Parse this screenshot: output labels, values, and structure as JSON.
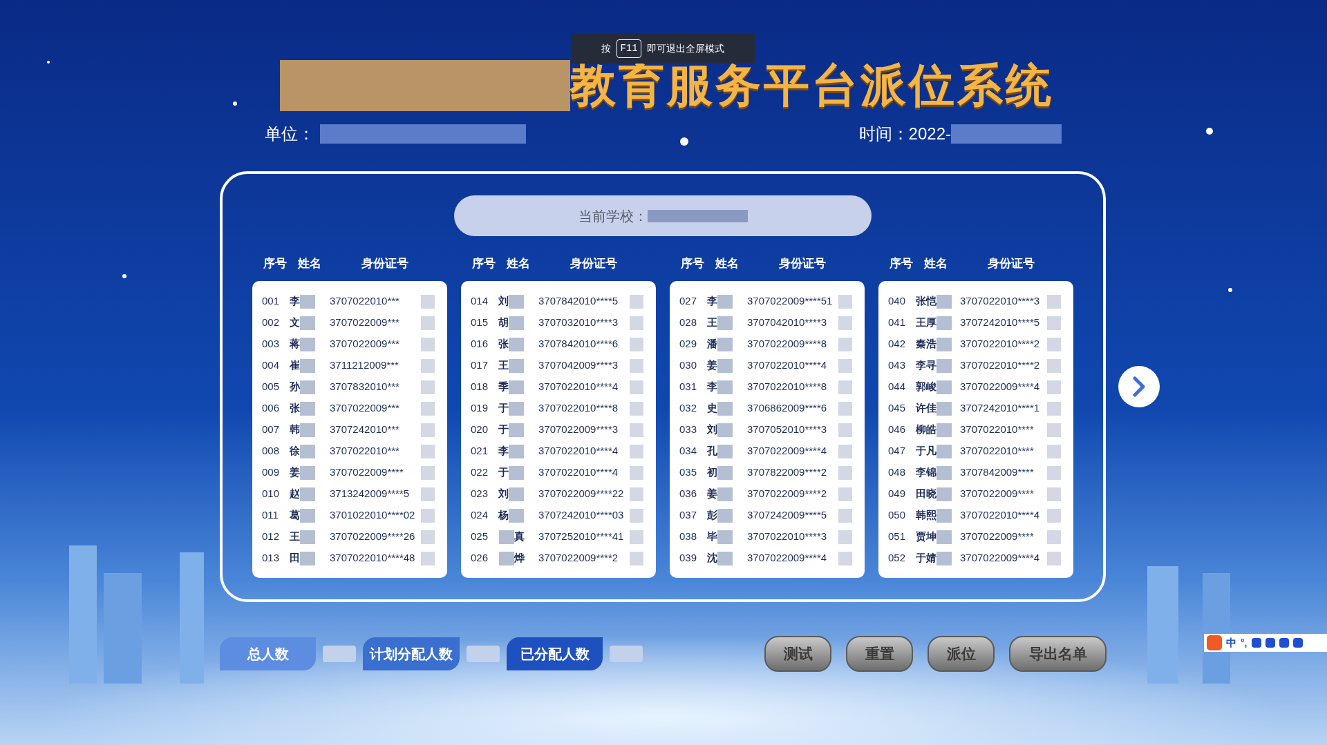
{
  "fullscreen_toast": {
    "prefix": "按",
    "key": "F11",
    "suffix": "即可退出全屏模式"
  },
  "title": "教育服务平台派位系统",
  "unit_label": "单位：",
  "time_label": "时间：",
  "time_value": "2022-",
  "school_label": "当前学校：",
  "columns": [
    {
      "headers": [
        "序号",
        "姓名",
        "身份证号"
      ],
      "rows": [
        {
          "no": "001",
          "name": "李",
          "id": "3707022010***",
          "kind": "name_first"
        },
        {
          "no": "002",
          "name": "文",
          "id": "3707022009***",
          "kind": "name_first"
        },
        {
          "no": "003",
          "name": "蒋",
          "id": "3707022009***",
          "kind": "name_first"
        },
        {
          "no": "004",
          "name": "崔",
          "id": "3711212009***",
          "kind": "name_first"
        },
        {
          "no": "005",
          "name": "孙",
          "id": "3707832010***",
          "kind": "name_first"
        },
        {
          "no": "006",
          "name": "张",
          "id": "3707022009***",
          "kind": "name_first"
        },
        {
          "no": "007",
          "name": "韩",
          "id": "3707242010***",
          "kind": "name_first"
        },
        {
          "no": "008",
          "name": "徐",
          "id": "3707022010***",
          "kind": "name_first"
        },
        {
          "no": "009",
          "name": "姜",
          "id": "3707022009****",
          "kind": "name_first"
        },
        {
          "no": "010",
          "name": "赵",
          "id": "3713242009****5",
          "kind": "name_first"
        },
        {
          "no": "011",
          "name": "葛",
          "id": "3701022010****02",
          "kind": "name_first"
        },
        {
          "no": "012",
          "name": "王",
          "id": "3707022009****26",
          "kind": "name_first"
        },
        {
          "no": "013",
          "name": "田",
          "id": "3707022010****48",
          "kind": "name_first"
        }
      ]
    },
    {
      "headers": [
        "序号",
        "姓名",
        "身份证号"
      ],
      "rows": [
        {
          "no": "014",
          "name": "刘",
          "id": "3707842010****5",
          "kind": "name_first"
        },
        {
          "no": "015",
          "name": "胡",
          "id": "3707032010****3",
          "kind": "name_first"
        },
        {
          "no": "016",
          "name": "张",
          "id": "3707842010****6",
          "kind": "name_first"
        },
        {
          "no": "017",
          "name": "王",
          "id": "3707042009****3",
          "kind": "name_first"
        },
        {
          "no": "018",
          "name": "季",
          "id": "3707022010****4",
          "kind": "name_first"
        },
        {
          "no": "019",
          "name": "于",
          "id": "3707022010****8",
          "kind": "name_first"
        },
        {
          "no": "020",
          "name": "于",
          "id": "3707022009****3",
          "kind": "name_first"
        },
        {
          "no": "021",
          "name": "李",
          "id": "3707022010****4",
          "kind": "name_first"
        },
        {
          "no": "022",
          "name": "于",
          "id": "3707022010****4",
          "kind": "name_first"
        },
        {
          "no": "023",
          "name": "刘",
          "id": "3707022009****22",
          "kind": "name_first"
        },
        {
          "no": "024",
          "name": "杨",
          "id": "3707242010****03",
          "kind": "name_first"
        },
        {
          "no": "025",
          "name": "真",
          "id": "3707252010****41",
          "kind": "mask_first"
        },
        {
          "no": "026",
          "name": "烨",
          "id": "3707022009****2",
          "kind": "mask_first"
        }
      ]
    },
    {
      "headers": [
        "序号",
        "姓名",
        "身份证号"
      ],
      "rows": [
        {
          "no": "027",
          "name": "李",
          "id": "3707022009****51",
          "kind": "name_first"
        },
        {
          "no": "028",
          "name": "王",
          "id": "3707042010****3",
          "kind": "name_first"
        },
        {
          "no": "029",
          "name": "潘",
          "id": "3707022009****8",
          "kind": "name_first"
        },
        {
          "no": "030",
          "name": "姜",
          "id": "3707022010****4",
          "kind": "name_first"
        },
        {
          "no": "031",
          "name": "李",
          "id": "3707022010****8",
          "kind": "name_first"
        },
        {
          "no": "032",
          "name": "史",
          "id": "3706862009****6",
          "kind": "name_first"
        },
        {
          "no": "033",
          "name": "刘",
          "id": "3707052010****3",
          "kind": "name_first"
        },
        {
          "no": "034",
          "name": "孔",
          "id": "3707022009****4",
          "kind": "name_first"
        },
        {
          "no": "035",
          "name": "初",
          "id": "3707822009****2",
          "kind": "name_first"
        },
        {
          "no": "036",
          "name": "姜",
          "id": "3707022009****2",
          "kind": "name_first"
        },
        {
          "no": "037",
          "name": "彭",
          "id": "3707242009****5",
          "kind": "name_first"
        },
        {
          "no": "038",
          "name": "毕",
          "id": "3707022010****3",
          "kind": "name_first"
        },
        {
          "no": "039",
          "name": "沈",
          "id": "3707022009****4",
          "kind": "name_first"
        }
      ]
    },
    {
      "headers": [
        "序号",
        "姓名",
        "身份证号"
      ],
      "rows": [
        {
          "no": "040",
          "name": "张恺",
          "id": "3707022010****3",
          "kind": "name_first"
        },
        {
          "no": "041",
          "name": "王厚",
          "id": "3707242010****5",
          "kind": "name_first"
        },
        {
          "no": "042",
          "name": "秦浩",
          "id": "3707022010****2",
          "kind": "name_first"
        },
        {
          "no": "043",
          "name": "李寻",
          "id": "3707022010****2",
          "kind": "name_first"
        },
        {
          "no": "044",
          "name": "郭峻",
          "id": "3707022009****4",
          "kind": "name_first"
        },
        {
          "no": "045",
          "name": "许佳",
          "id": "3707242010****1",
          "kind": "name_first"
        },
        {
          "no": "046",
          "name": "柳皓",
          "id": "3707022010****",
          "kind": "name_first"
        },
        {
          "no": "047",
          "name": "于凡",
          "id": "3707022010****",
          "kind": "name_first"
        },
        {
          "no": "048",
          "name": "李锦",
          "id": "3707842009****",
          "kind": "name_first"
        },
        {
          "no": "049",
          "name": "田晓",
          "id": "3707022009****",
          "kind": "name_first"
        },
        {
          "no": "050",
          "name": "韩熙",
          "id": "3707022010****4",
          "kind": "name_first"
        },
        {
          "no": "051",
          "name": "贾坤",
          "id": "3707022009****",
          "kind": "name_first"
        },
        {
          "no": "052",
          "name": "于婧",
          "id": "3707022009****4",
          "kind": "name_first"
        }
      ]
    }
  ],
  "stats": [
    {
      "label": "总人数",
      "kind": "light"
    },
    {
      "label": "计划分配人数",
      "kind": "medium"
    },
    {
      "label": "已分配人数",
      "kind": "dark"
    }
  ],
  "buttons": [
    "测试",
    "重置",
    "派位",
    "导出名单"
  ],
  "ime": {
    "label": "中",
    "punct": "°,"
  }
}
